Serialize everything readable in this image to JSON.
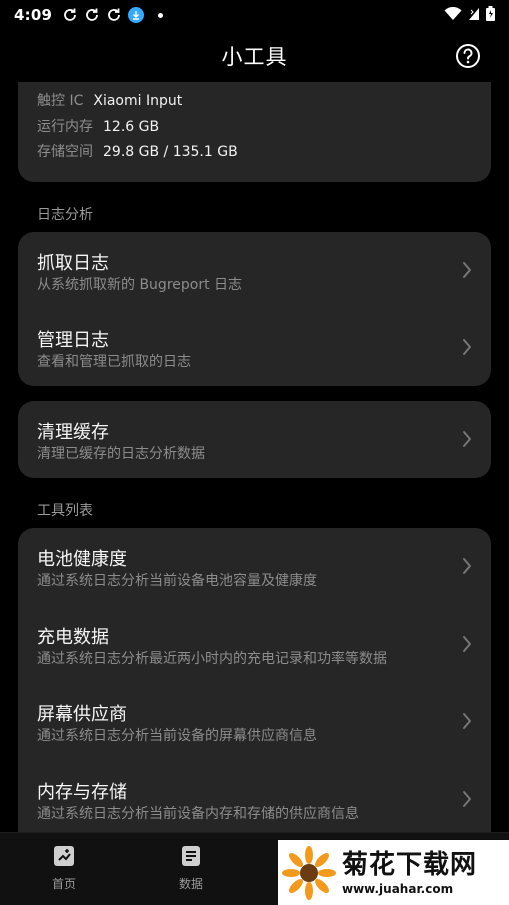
{
  "status_bar": {
    "time": "4:09",
    "icons_left": [
      "sync-icon",
      "sync-icon",
      "sync-icon",
      "download-icon",
      "dot-icon"
    ],
    "icons_right": [
      "wifi-icon",
      "signal-icon",
      "battery-icon"
    ]
  },
  "app_bar": {
    "title": "小工具",
    "help_icon": "question-circle-icon"
  },
  "device_info": [
    {
      "label": "触控 IC",
      "value": "Xiaomi Input"
    },
    {
      "label": "运行内存",
      "value": "12.6 GB"
    },
    {
      "label": "存储空间",
      "value": "29.8 GB / 135.1 GB"
    }
  ],
  "sections": {
    "log_analysis": "日志分析",
    "tool_list": "工具列表"
  },
  "log_items": [
    {
      "title": "抓取日志",
      "subtitle": "从系统抓取新的 Bugreport 日志"
    },
    {
      "title": "管理日志",
      "subtitle": "查看和管理已抓取的日志"
    }
  ],
  "cache_item": {
    "title": "清理缓存",
    "subtitle": "清理已缓存的日志分析数据"
  },
  "tool_items": [
    {
      "title": "电池健康度",
      "subtitle": "通过系统日志分析当前设备电池容量及健康度"
    },
    {
      "title": "充电数据",
      "subtitle": "通过系统日志分析最近两小时内的充电记录和功率等数据"
    },
    {
      "title": "屏幕供应商",
      "subtitle": "通过系统日志分析当前设备的屏幕供应商信息"
    },
    {
      "title": "内存与存储",
      "subtitle": "通过系统日志分析当前设备内存和存储的供应商信息"
    }
  ],
  "bottom_nav": [
    {
      "label": "首页",
      "icon": "home-icon"
    },
    {
      "label": "数据",
      "icon": "document-icon"
    }
  ],
  "watermark": {
    "title": "菊花下载网",
    "url": "www.juahar.com"
  },
  "colors": {
    "background": "#000000",
    "card": "#262626",
    "text_primary": "#f5f5f5",
    "text_secondary": "#8c8c8c"
  }
}
